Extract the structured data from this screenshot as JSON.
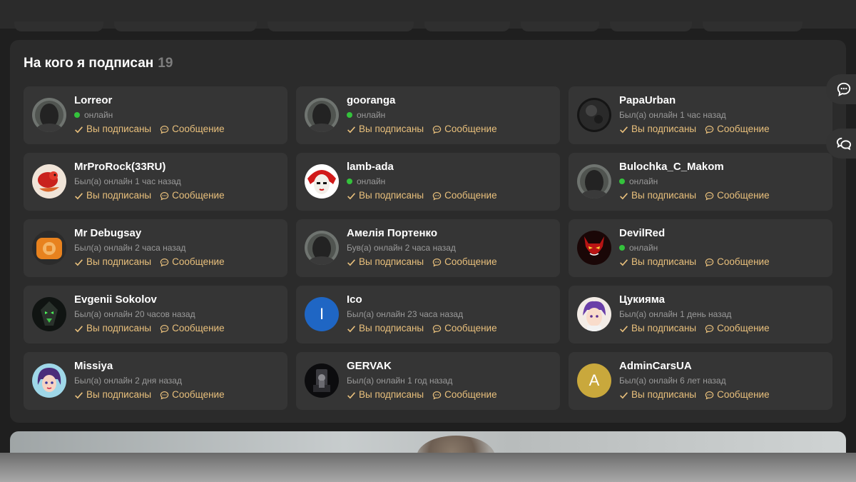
{
  "section": {
    "title": "На кого я подписан",
    "count": "19"
  },
  "users": [
    {
      "name": "Lorreor",
      "status": "онлайн",
      "online": true,
      "avatar": "default-avatar"
    },
    {
      "name": "gooranga",
      "status": "онлайн",
      "online": true,
      "avatar": "default-avatar"
    },
    {
      "name": "PapaUrban",
      "status": "Был(а) онлайн 1 час назад",
      "online": false,
      "avatar": "dark-sphere-avatar"
    },
    {
      "name": "MrProRock(33RU)",
      "status": "Был(а) онлайн 1 час назад",
      "online": false,
      "avatar": "red-bird-avatar"
    },
    {
      "name": "lamb-ada",
      "status": "онлайн",
      "online": true,
      "avatar": "face-red-hair-avatar"
    },
    {
      "name": "Bulochka_C_Makom",
      "status": "онлайн",
      "online": true,
      "avatar": "default-avatar"
    },
    {
      "name": "Mr Debugsay",
      "status": "Был(а) онлайн 2 часа назад",
      "online": false,
      "avatar": "orange-icon-avatar"
    },
    {
      "name": "Амелія Портенко",
      "status": "Був(а) онлайн 2 часа назад",
      "online": false,
      "avatar": "default-avatar"
    },
    {
      "name": "DevilRed",
      "status": "онлайн",
      "online": true,
      "avatar": "red-devil-avatar"
    },
    {
      "name": "Evgenii Sokolov",
      "status": "Был(а) онлайн 20 часов назад",
      "online": false,
      "avatar": "green-robot-avatar"
    },
    {
      "name": "Ico",
      "status": "Был(а) онлайн 23 часа назад",
      "online": false,
      "avatar": "letter-avatar",
      "letter": "I",
      "color": "#1f66c4"
    },
    {
      "name": "Цукияма",
      "status": "Был(а) онлайн 1 день назад",
      "online": false,
      "avatar": "anime-purple-hair-avatar"
    },
    {
      "name": "Missiya",
      "status": "Был(а) онлайн 2 дня назад",
      "online": false,
      "avatar": "anime-girl-avatar"
    },
    {
      "name": "GERVAK",
      "status": "Был(а) онлайн 1 год назад",
      "online": false,
      "avatar": "throne-avatar"
    },
    {
      "name": "AdminCarsUA",
      "status": "Был(а) онлайн 6 лет назад",
      "online": false,
      "avatar": "letter-avatar",
      "letter": "A",
      "color": "#c9a83c"
    }
  ],
  "actions": {
    "subscribed_label": "Вы подписаны",
    "message_label": "Сообщение"
  },
  "colors": {
    "accent": "#e9c07c",
    "online": "#34c23c",
    "card": "#353535",
    "panel": "#2b2b2b"
  },
  "side_buttons": [
    {
      "icon": "chat-bubble-icon"
    },
    {
      "icon": "conversations-icon"
    }
  ]
}
